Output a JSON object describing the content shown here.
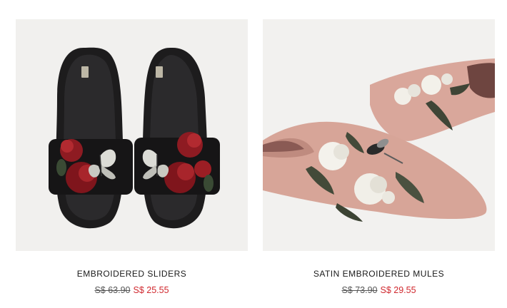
{
  "products": [
    {
      "name": "EMBROIDERED SLIDERS",
      "old_price": "S$ 63.90",
      "new_price": "S$ 25.55",
      "image": "black-embroidered-sliders-photo"
    },
    {
      "name": "SATIN EMBROIDERED MULES",
      "old_price": "S$ 73.90",
      "new_price": "S$ 29.55",
      "image": "pink-satin-embroidered-mules-photo"
    }
  ],
  "colors": {
    "sale_price": "#d0282e",
    "old_price": "#555555",
    "photo_background": "#f2f1ef"
  }
}
